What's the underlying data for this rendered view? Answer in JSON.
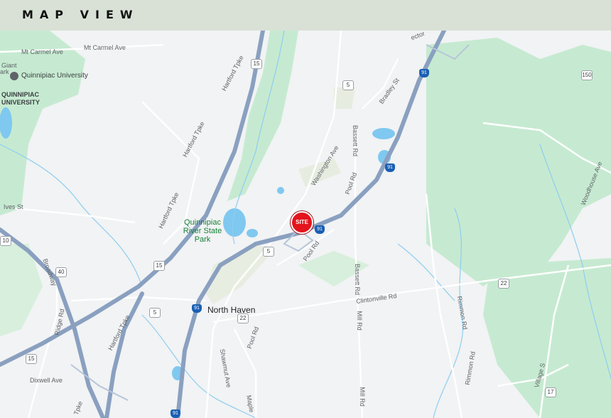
{
  "header": {
    "title": "MAP VIEW"
  },
  "site_marker": {
    "label": "SITE"
  },
  "town": {
    "name": "North Haven"
  },
  "parks": [
    {
      "name": "Quinnipiac River State Park"
    }
  ],
  "university": {
    "name": "Quinnipiac University",
    "campus_label": "QUINNIPIAC UNIVERSITY"
  },
  "roads": {
    "mt_carmel_ave_1": "Mt Carmel Ave",
    "mt_carmel_ave_2": "Mt Carmel Ave",
    "giant": "Giant",
    "park": "ark",
    "ives_st": "Ives St",
    "hartford_tpke_1": "Hartford Tpke",
    "hartford_tpke_2": "Hartford Tpke",
    "hartford_tpke_3": "Hartford Tpke",
    "hartford_tpke_4": "Hartford Tpke",
    "washington_ave": "Washington Ave",
    "bradley_st": "Bradley St",
    "bassett_rd_1": "Bassett Rd",
    "bassett_rd_2": "Bassett Rd",
    "pool_rd_1": "Pool Rd",
    "pool_rd_2": "Pool Rd",
    "pool_rd_3": "Pool Rd",
    "clintonville_rd": "Clintonville Rd",
    "rimmon_rd_1": "Rimmon Rd",
    "rimmon_rd_2": "Rimmon Rd",
    "mill_rd_1": "Mill Rd",
    "mill_rd_2": "Mill Rd",
    "woodhouse_ave": "Woodhouse Ave",
    "village_st": "Village S",
    "broadway": "Broadway",
    "ridge_rd": "Ridge Rd",
    "dixwell_ave": "Dixwell Ave",
    "shawmut_ave": "Shawmut Ave",
    "maple": "Maple",
    "tpke": "Tpke",
    "connector": "ector"
  },
  "shields": {
    "rt15_a": "15",
    "rt15_b": "15",
    "rt15_c": "15",
    "rt5_a": "5",
    "rt5_b": "5",
    "rt5_c": "5",
    "rt22_a": "22",
    "rt22_b": "22",
    "rt40": "40",
    "rt150": "150",
    "rt17": "17",
    "rt10": "10",
    "i91_a": "91",
    "i91_b": "91",
    "i91_c": "91",
    "i91_d": "91",
    "i91_e": "91"
  },
  "colors": {
    "header_bg": "#d9e1d6",
    "site_marker": "#e3141c",
    "water": "#7fc8f0",
    "park": "#bfe6c8",
    "highway": "#8aa0c0"
  }
}
